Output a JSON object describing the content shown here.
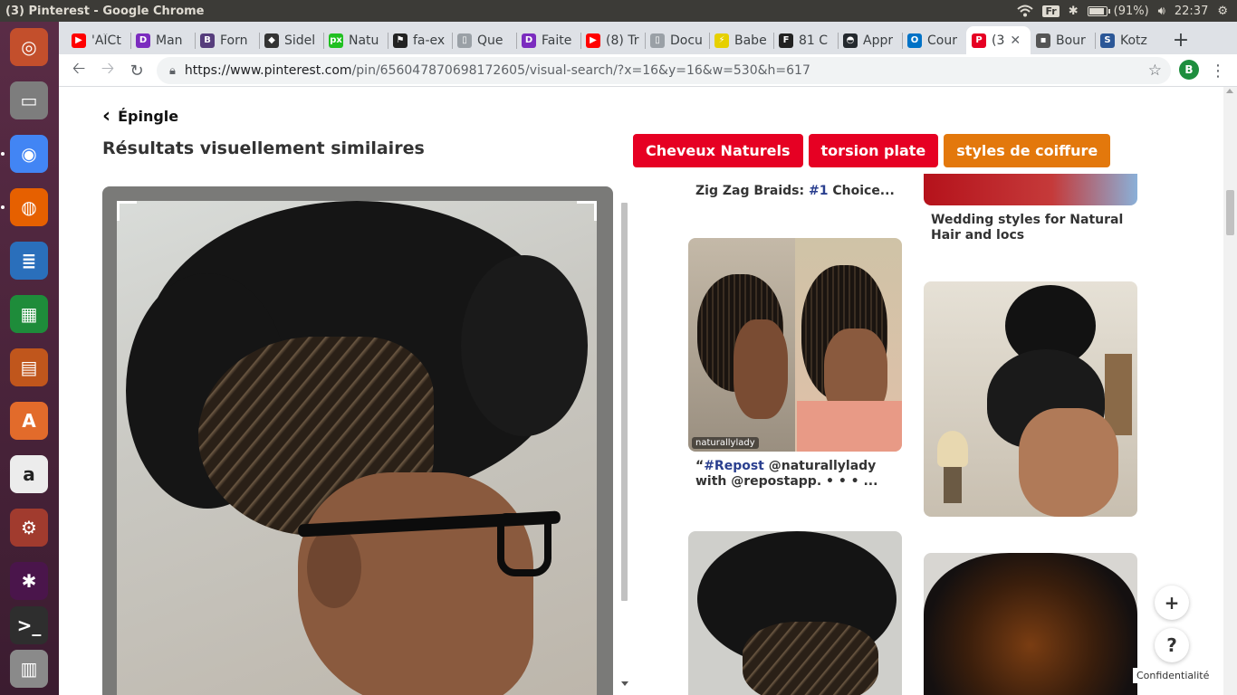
{
  "window": {
    "title": "(3) Pinterest - Google Chrome"
  },
  "topbar": {
    "keyboard": "Fr",
    "battery": "(91%)",
    "battery_level": 0.91,
    "clock": "22:37"
  },
  "launcher": {
    "items": [
      {
        "name": "ubuntu-dash-icon",
        "color": "#c34f2c",
        "glyph": "◎"
      },
      {
        "name": "files-icon",
        "color": "#7d7d7d",
        "glyph": "▭"
      },
      {
        "name": "chrome-icon",
        "color": "#4285f4",
        "glyph": "◉"
      },
      {
        "name": "firefox-icon",
        "color": "#e66000",
        "glyph": "◍"
      },
      {
        "name": "writer-icon",
        "color": "#2a6fbb",
        "glyph": "≣"
      },
      {
        "name": "calc-icon",
        "color": "#1e8c3a",
        "glyph": "▦"
      },
      {
        "name": "impress-icon",
        "color": "#c0561c",
        "glyph": "▤"
      },
      {
        "name": "software-center-icon",
        "color": "#e26b2b",
        "glyph": "A"
      },
      {
        "name": "amazon-icon",
        "color": "#ececec",
        "glyph": "a"
      },
      {
        "name": "settings-icon",
        "color": "#a13b2e",
        "glyph": "⚙"
      },
      {
        "name": "slack-icon",
        "color": "#4a154b",
        "glyph": "✱"
      },
      {
        "name": "terminal-icon",
        "color": "#2e2e2e",
        "glyph": ">_"
      },
      {
        "name": "workspaces-icon",
        "color": "#8a8a8a",
        "glyph": "▥"
      }
    ]
  },
  "tabs": [
    {
      "label": "'AÏCt",
      "fav": "#ff0000",
      "glyph": "▶"
    },
    {
      "label": "Man",
      "fav": "#7b2cbf",
      "glyph": "D"
    },
    {
      "label": "Forn",
      "fav": "#563d7c",
      "glyph": "B"
    },
    {
      "label": "Sidel",
      "fav": "#333333",
      "glyph": "◆"
    },
    {
      "label": "Natu",
      "fav": "#20c020",
      "glyph": "px"
    },
    {
      "label": "fa-ex",
      "fav": "#222222",
      "glyph": "⚑"
    },
    {
      "label": "Que",
      "fav": "#9aa0a6",
      "glyph": "▯"
    },
    {
      "label": "Faite",
      "fav": "#7b2cbf",
      "glyph": "D"
    },
    {
      "label": "(8) Tr",
      "fav": "#ff0000",
      "glyph": "▶"
    },
    {
      "label": "Docu",
      "fav": "#9aa0a6",
      "glyph": "▯"
    },
    {
      "label": "Babe",
      "fav": "#e6d000",
      "glyph": "⚡"
    },
    {
      "label": "81 C",
      "fav": "#222222",
      "glyph": "F"
    },
    {
      "label": "Appr",
      "fav": "#24292e",
      "glyph": "◓"
    },
    {
      "label": "Cour",
      "fav": "#0072c6",
      "glyph": "O"
    },
    {
      "label": "(3",
      "fav": "#e60023",
      "glyph": "P",
      "active": true
    },
    {
      "label": "Bour",
      "fav": "#555555",
      "glyph": "▪"
    },
    {
      "label": "Kotz",
      "fav": "#2b5797",
      "glyph": "S"
    }
  ],
  "toolbar": {
    "url_host": "https://www.pinterest.com",
    "url_path": "/pin/656047870698172605/visual-search/?x=16&y=16&w=530&h=617",
    "profile_initial": "B"
  },
  "page": {
    "back_label": "Épingle",
    "heading": "Résultats visuellement similaires",
    "pills": [
      {
        "label": "Cheveux Naturels",
        "color": "#e60023"
      },
      {
        "label": "torsion plate",
        "color": "#e60023"
      },
      {
        "label": "styles de coiffure",
        "color": "#e3780c"
      }
    ],
    "cards": {
      "col1_top_caption_tag": "#1",
      "col1_top_caption_pre": "Zig Zag Braids: ",
      "col1_top_caption_post": " Choice...",
      "col2_top_caption": "Wedding styles for Natural Hair and locs",
      "repost_tag": "#Repost",
      "repost_text": " @naturallylady with @repostapp. • • • ...",
      "watermark": "naturallylady"
    },
    "privacy": "Confidentialité"
  }
}
